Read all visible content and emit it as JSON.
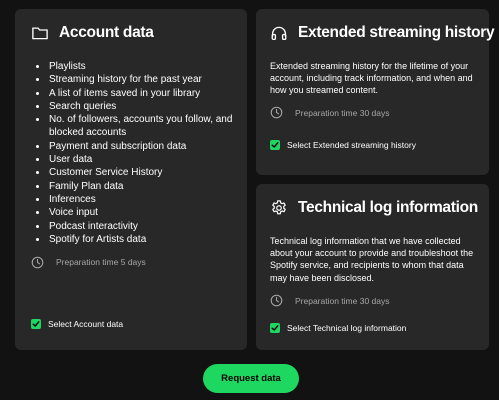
{
  "account": {
    "title": "Account data",
    "icon": "folder-icon",
    "items": [
      "Playlists",
      "Streaming history for the past year",
      "A list of items saved in your library",
      "Search queries",
      "No. of followers, accounts you follow, and blocked accounts",
      "Payment and subscription data",
      "User data",
      "Customer Service History",
      "Family Plan data",
      "Inferences",
      "Voice input",
      "Podcast interactivity",
      "Spotify for Artists data"
    ],
    "preparation_time": "Preparation time 5 days",
    "checkbox_label": "Select Account data",
    "checked": true
  },
  "extended": {
    "title": "Extended streaming history",
    "icon": "headphones-icon",
    "description": "Extended streaming history for the lifetime of your account, including track information, and when and how you streamed content.",
    "preparation_time": "Preparation time 30 days",
    "checkbox_label": "Select Extended streaming history",
    "checked": true
  },
  "technical": {
    "title": "Technical log information",
    "icon": "gear-icon",
    "description": "Technical log information that we have collected about your account to provide and troubleshoot the Spotify service, and recipients to whom that data may have been disclosed.",
    "preparation_time": "Preparation time 30 days",
    "checkbox_label": "Select Technical log information",
    "checked": true
  },
  "request_button": "Request data",
  "colors": {
    "background": "#121212",
    "card": "#282828",
    "accent": "#1ed760",
    "muted_text": "#a7a7a7"
  }
}
